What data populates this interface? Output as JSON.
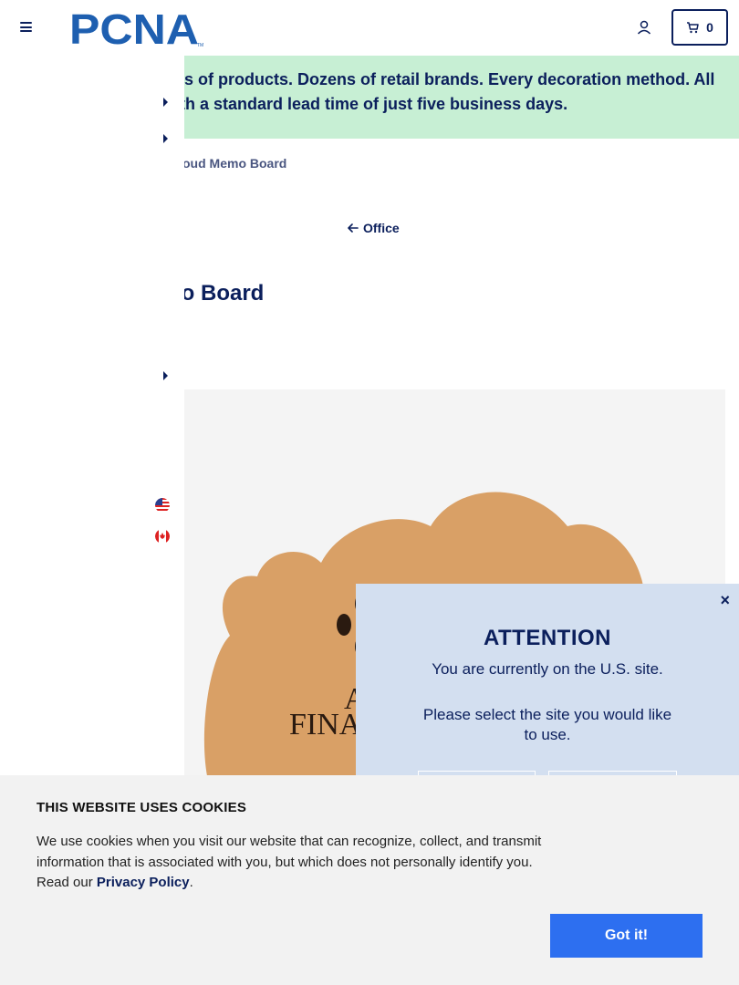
{
  "header": {
    "logo_text": "PCNA",
    "logo_tm": "TM",
    "cart_count": "0",
    "menu_icon": "hamburger-icon",
    "account_icon": "user-icon",
    "cart_icon": "cart-icon"
  },
  "banner": {
    "text": "ls of products. Dozens of retail brands. Every decoration method. All th a standard lead time of just five business days."
  },
  "breadcrumb": {
    "current": "oud Memo Board"
  },
  "back_link": {
    "label": "Office"
  },
  "product": {
    "title": "no Board",
    "image_text_1": "AL",
    "image_text_2": "FINA"
  },
  "modal": {
    "title": "ATTENTION",
    "line1": "You are currently on the U.S. site.",
    "line2": "Please select the site you would like to use.",
    "close": "×"
  },
  "cookie": {
    "title": "THIS WEBSITE USES COOKIES",
    "text_before": "We use cookies when you visit our website that can recognize, collect, and transmit information that is associated with you, but which does not personally identify you. Read our ",
    "link": "Privacy Policy",
    "text_after": ".",
    "button": "Got it!"
  },
  "colors": {
    "brand_navy": "#0b1f5c",
    "banner_green": "#c7efd4",
    "modal_bg": "#d3dff0",
    "cookie_btn": "#2d6ff0"
  }
}
